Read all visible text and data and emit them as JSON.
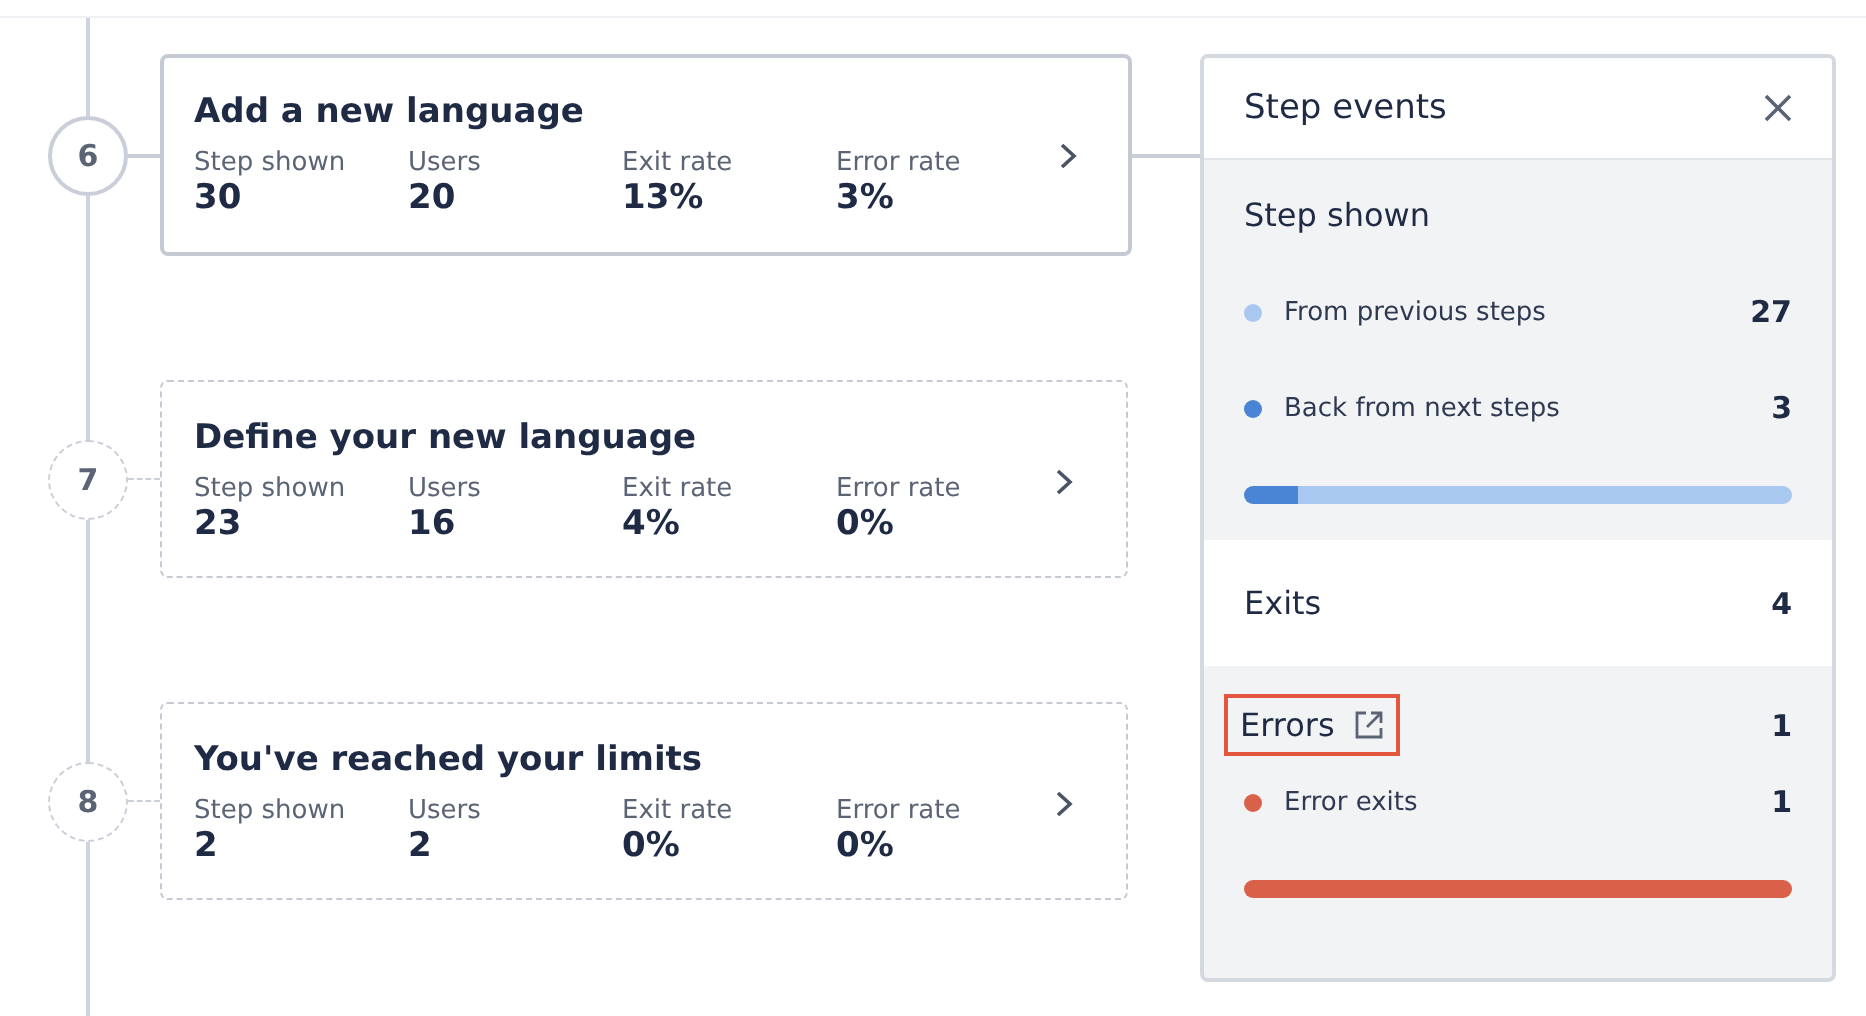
{
  "steps": [
    {
      "number": "6",
      "title": "Add a new language",
      "selected": true,
      "stats": [
        {
          "label": "Step shown",
          "value": "30"
        },
        {
          "label": "Users",
          "value": "20"
        },
        {
          "label": "Exit rate",
          "value": "13%"
        },
        {
          "label": "Error rate",
          "value": "3%"
        }
      ]
    },
    {
      "number": "7",
      "title": "Define your new language",
      "selected": false,
      "stats": [
        {
          "label": "Step shown",
          "value": "23"
        },
        {
          "label": "Users",
          "value": "16"
        },
        {
          "label": "Exit rate",
          "value": "4%"
        },
        {
          "label": "Error rate",
          "value": "0%"
        }
      ]
    },
    {
      "number": "8",
      "title": "You've reached your limits",
      "selected": false,
      "stats": [
        {
          "label": "Step shown",
          "value": "2"
        },
        {
          "label": "Users",
          "value": "2"
        },
        {
          "label": "Exit rate",
          "value": "0%"
        },
        {
          "label": "Error rate",
          "value": "0%"
        }
      ]
    }
  ],
  "panel": {
    "title": "Step events",
    "sections": [
      {
        "kind": "breakdown",
        "title": "Step shown",
        "items": [
          {
            "label": "From previous steps",
            "value": "27",
            "color": "#a8c8ef",
            "level": 0.9
          },
          {
            "label": "Back from next steps",
            "value": "3",
            "color": "#4a84d4",
            "level": 0.1
          }
        ]
      },
      {
        "kind": "total",
        "title": "Exits",
        "value": "4"
      },
      {
        "kind": "breakdown",
        "title": "Errors",
        "value": "1",
        "highlighted": true,
        "link": true,
        "items": [
          {
            "label": "Error exits",
            "value": "1",
            "color": "#d9614a",
            "level": 1
          }
        ]
      }
    ]
  }
}
